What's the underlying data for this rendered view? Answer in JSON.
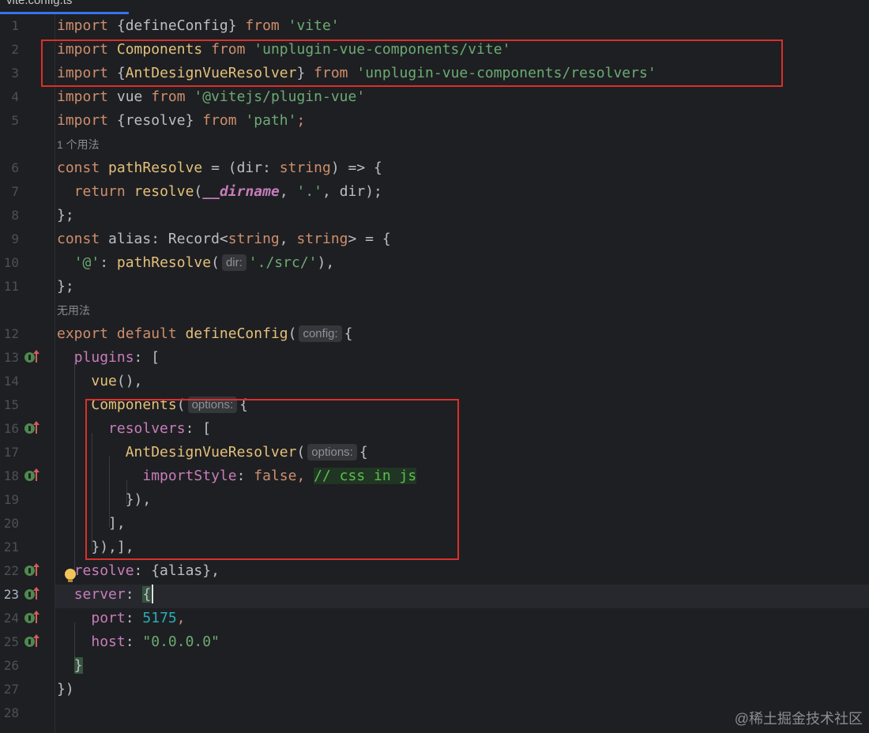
{
  "editor": {
    "tab_title": "vite.config.ts",
    "line_numbers": [
      "1",
      "2",
      "3",
      "4",
      "5",
      "6",
      "7",
      "8",
      "9",
      "10",
      "11",
      "12",
      "13",
      "14",
      "15",
      "16",
      "17",
      "18",
      "19",
      "20",
      "21",
      "22",
      "23",
      "24",
      "25",
      "26",
      "27",
      "28"
    ],
    "current_line": "23",
    "usage_hint_1": "1 个用法",
    "usage_hint_2": "无用法",
    "hints": {
      "dir": "dir:",
      "config": "config:",
      "options": "options:"
    },
    "code": {
      "l1": {
        "kw1": "import",
        "t1": " {defineConfig} ",
        "kw2": "from",
        "t2": " ",
        "s": "'vite'"
      },
      "l2": {
        "kw1": "import",
        "t1": " ",
        "fn": "Components",
        "t2": " ",
        "kw2": "from",
        "t3": " ",
        "s": "'unplugin-vue-components/vite'"
      },
      "l3": {
        "kw1": "import",
        "t1": " {",
        "fn": "AntDesignVueResolver",
        "t2": "} ",
        "kw2": "from",
        "t3": " ",
        "s": "'unplugin-vue-components/resolvers'"
      },
      "l4": {
        "kw1": "import",
        "t1": " vue ",
        "kw2": "from",
        "t2": " ",
        "s": "'@vitejs/plugin-vue'"
      },
      "l5": {
        "kw1": "import",
        "t1": " {resolve} ",
        "kw2": "from",
        "t2": " ",
        "s": "'path'",
        "t3": ";"
      },
      "l6": {
        "kw1": "const",
        "t1": " ",
        "fn": "pathResolve",
        "t2": " = (dir: ",
        "kw2": "string",
        "t3": ") => {"
      },
      "l7": {
        "ind": "  ",
        "kw1": "return",
        "t1": " ",
        "fn": "resolve",
        "t2": "(",
        "it": "__dirname",
        "t3": ", ",
        "s": "'.'",
        "t4": ", dir);"
      },
      "l8": {
        "t1": "};"
      },
      "l9": {
        "kw1": "const",
        "t1": " alias: Record<",
        "kw2": "string",
        "t2": ", ",
        "kw3": "string",
        "t3": "> = {"
      },
      "l10": {
        "ind": "  ",
        "s1": "'@'",
        "t1": ": ",
        "fn": "pathResolve",
        "t2": "(",
        "s2": "'./src/'",
        "t3": "),"
      },
      "l11": {
        "t1": "};"
      },
      "l12": {
        "kw1": "export",
        "t1": " ",
        "kw2": "default",
        "t2": " ",
        "fn": "defineConfig",
        "t3": "(",
        "t4": "{"
      },
      "l13": {
        "ind": "  ",
        "p": "plugins",
        "t1": ": ["
      },
      "l14": {
        "ind": "    ",
        "fn": "vue",
        "t1": "(),"
      },
      "l15": {
        "ind": "    ",
        "fn": "Components",
        "t1": "(",
        "t2": "{"
      },
      "l16": {
        "ind": "      ",
        "p": "resolvers",
        "t1": ": ["
      },
      "l17": {
        "ind": "        ",
        "fn": "AntDesignVueResolver",
        "t1": "(",
        "t2": "{"
      },
      "l18": {
        "ind": "          ",
        "p": "importStyle",
        "t1": ": ",
        "kw": "false",
        "t2": ", ",
        "cm": "// css in js"
      },
      "l19": {
        "ind": "        ",
        "t1": "}),"
      },
      "l20": {
        "ind": "      ",
        "t1": "],"
      },
      "l21": {
        "ind": "    ",
        "t1": "}),],"
      },
      "l22": {
        "ind": "  ",
        "p": "resolve",
        "t1": ": {alias},"
      },
      "l23": {
        "ind": "  ",
        "p": "server",
        "t1": ": ",
        "b": "{"
      },
      "l24": {
        "ind": "    ",
        "p": "port",
        "t1": ": ",
        "n": "5175",
        "t2": ","
      },
      "l25": {
        "ind": "    ",
        "p": "host",
        "t1": ": ",
        "s": "\"0.0.0.0\""
      },
      "l26": {
        "ind": "  ",
        "b": "}"
      },
      "l27": {
        "t1": "})"
      }
    }
  },
  "watermark": "@稀土掘金技术社区",
  "colors": {
    "background": "#1e1f22",
    "keyword": "#cf8e6d",
    "function": "#e4c07a",
    "string": "#6aab73",
    "property": "#c77dbb",
    "number": "#2aacb8",
    "highlight_box": "#d9302c"
  }
}
